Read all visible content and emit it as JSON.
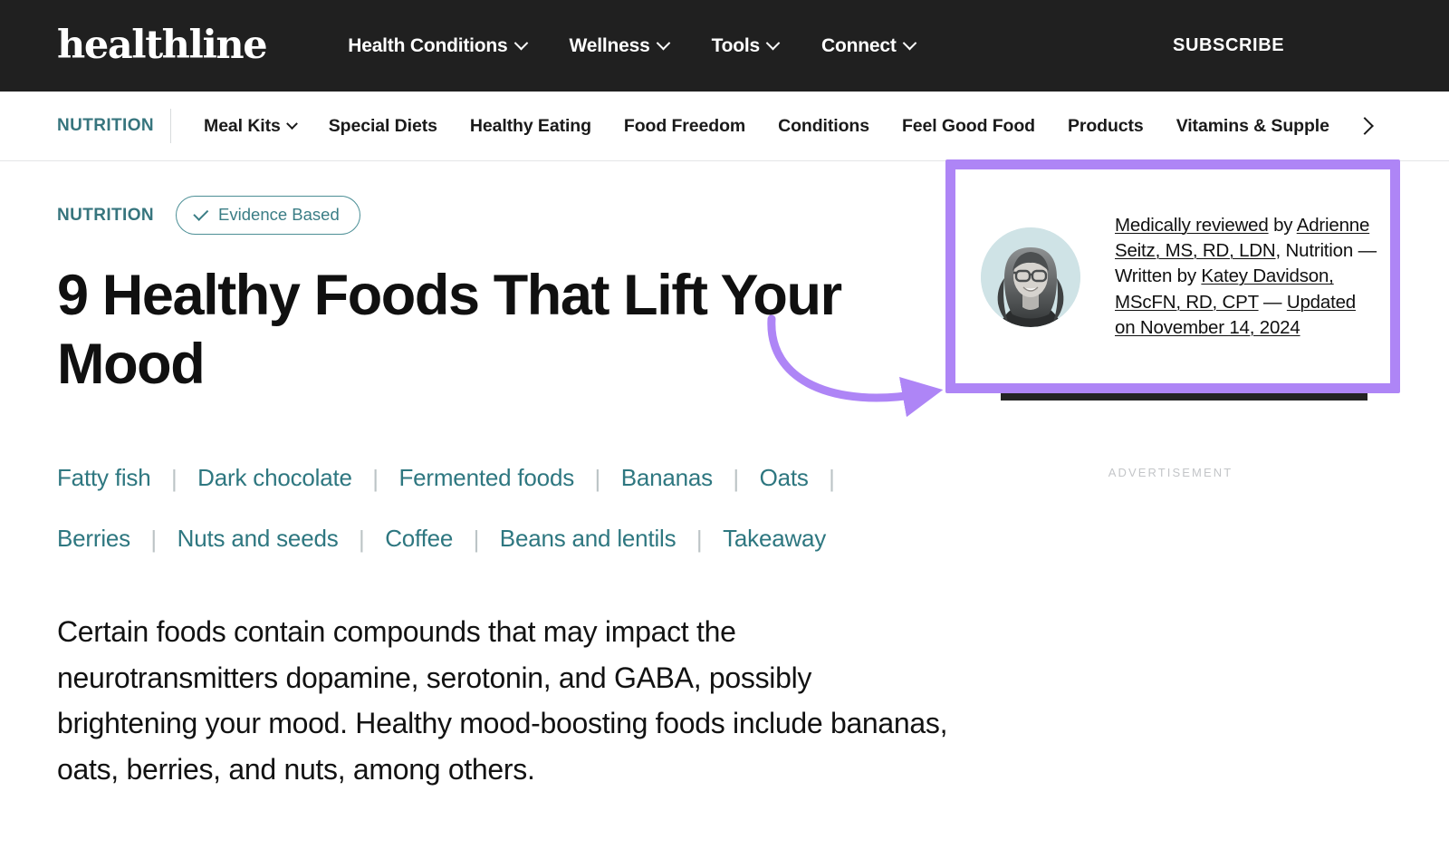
{
  "colors": {
    "header_bg": "#202020",
    "teal_accent": "#37757e",
    "annotation_purple": "#ae85f6",
    "text": "#101010",
    "avatar_bg": "#cfe3e6"
  },
  "header": {
    "brand": "healthline",
    "nav": [
      {
        "label": "Health Conditions",
        "has_chevron": true,
        "icon": "chevron-down-icon"
      },
      {
        "label": "Wellness",
        "has_chevron": true,
        "icon": "chevron-down-icon"
      },
      {
        "label": "Tools",
        "has_chevron": true,
        "icon": "chevron-down-icon"
      },
      {
        "label": "Connect",
        "has_chevron": true,
        "icon": "chevron-down-icon"
      }
    ],
    "subscribe_label": "SUBSCRIBE"
  },
  "subnav": {
    "category": "NUTRITION",
    "items": [
      {
        "label": "Meal Kits",
        "has_chevron": true,
        "icon": "chevron-down-icon"
      },
      {
        "label": "Special Diets",
        "has_chevron": false
      },
      {
        "label": "Healthy Eating",
        "has_chevron": false
      },
      {
        "label": "Food Freedom",
        "has_chevron": false
      },
      {
        "label": "Conditions",
        "has_chevron": false
      },
      {
        "label": "Feel Good Food",
        "has_chevron": false
      },
      {
        "label": "Products",
        "has_chevron": false
      },
      {
        "label": "Vitamins & Supple",
        "has_chevron": false
      }
    ],
    "more_icon": "chevron-right-icon"
  },
  "article": {
    "kicker": "NUTRITION",
    "badge": {
      "label": "Evidence Based",
      "icon": "check-icon"
    },
    "title": "9 Healthy Foods That Lift Your Mood",
    "jump_links": [
      "Fatty fish",
      "Dark chocolate",
      "Fermented foods",
      "Bananas",
      "Oats",
      "Berries",
      "Nuts and seeds",
      "Coffee",
      "Beans and lentils",
      "Takeaway"
    ],
    "lede": "Certain foods contain compounds that may impact the neurotransmitters dopamine, serotonin, and GABA, possibly brightening your mood. Healthy mood-boosting foods include bananas, oats, berries, and nuts, among others."
  },
  "byline": {
    "avatar_alt": "Adrienne Seitz headshot",
    "reviewed_label": "Medically reviewed",
    "by_1": " by ",
    "reviewer_name": "Adrienne Seitz, MS, RD, LDN",
    "reviewer_dept": ", Nutrition ",
    "dash_1": "— Written by ",
    "author_name": "Katey Davidson, MScFN, RD, CPT",
    "dash_2": " — ",
    "updated_label": "Updated on November 14, 2024"
  },
  "rail": {
    "ad_label": "ADVERTISEMENT"
  },
  "annotation": {
    "type": "highlight-box-with-arrow",
    "target": "byline-box",
    "color": "#ae85f6"
  }
}
